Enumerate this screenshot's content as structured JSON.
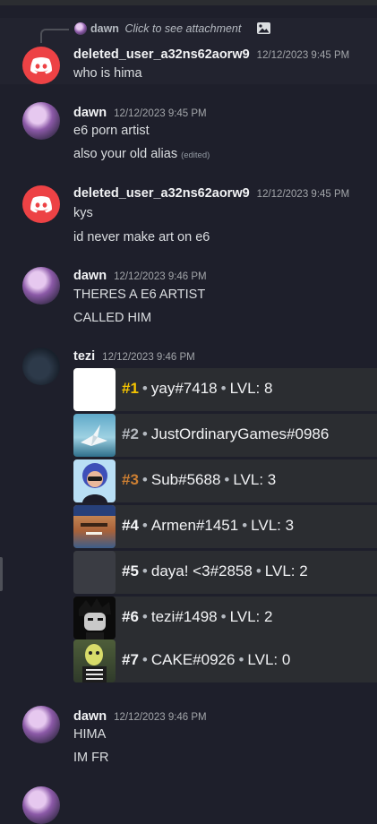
{
  "reply": {
    "username": "dawn",
    "text": "Click to see attachment"
  },
  "messages": [
    {
      "username": "deleted_user_a32ns62aorw9",
      "timestamp": "12/12/2023 9:45 PM",
      "lines": [
        "who is hima"
      ]
    },
    {
      "username": "dawn",
      "timestamp": "12/12/2023 9:45 PM",
      "lines": [
        "e6 porn artist",
        "also your old alias"
      ],
      "edited": "(edited)"
    },
    {
      "username": "deleted_user_a32ns62aorw9",
      "timestamp": "12/12/2023 9:45 PM",
      "lines": [
        "kys",
        "id never make art on e6"
      ]
    },
    {
      "username": "dawn",
      "timestamp": "12/12/2023 9:46 PM",
      "lines": [
        "THERES A E6 ARTIST",
        "CALLED HIM"
      ]
    },
    {
      "username": "tezi",
      "timestamp": "12/12/2023 9:46 PM",
      "lines": []
    },
    {
      "username": "dawn",
      "timestamp": "12/12/2023 9:46 PM",
      "lines": [
        "HIMA",
        "IM FR"
      ]
    }
  ],
  "leaderboard": [
    {
      "rank": "#1",
      "name": "yay#7418",
      "level": "LVL: 8",
      "rank_color": "#f5c400"
    },
    {
      "rank": "#2",
      "name": "JustOrdinaryGames#0986",
      "level": "",
      "rank_color": "#b5b9bf"
    },
    {
      "rank": "#3",
      "name": "Sub#5688",
      "level": "LVL: 3",
      "rank_color": "#cd7f32"
    },
    {
      "rank": "#4",
      "name": "Armen#1451",
      "level": "LVL: 3",
      "rank_color": "#f2f3f5"
    },
    {
      "rank": "#5",
      "name": "daya! <3#2858",
      "level": "LVL: 2",
      "rank_color": "#f2f3f5"
    },
    {
      "rank": "#6",
      "name": "tezi#1498",
      "level": "LVL: 2",
      "rank_color": "#f2f3f5"
    },
    {
      "rank": "#7",
      "name": "CAKE#0926",
      "level": "LVL: 0",
      "rank_color": "#f2f3f5"
    }
  ],
  "colors": {
    "discord_red": "#ed4245",
    "background": "#1e1f2b"
  }
}
